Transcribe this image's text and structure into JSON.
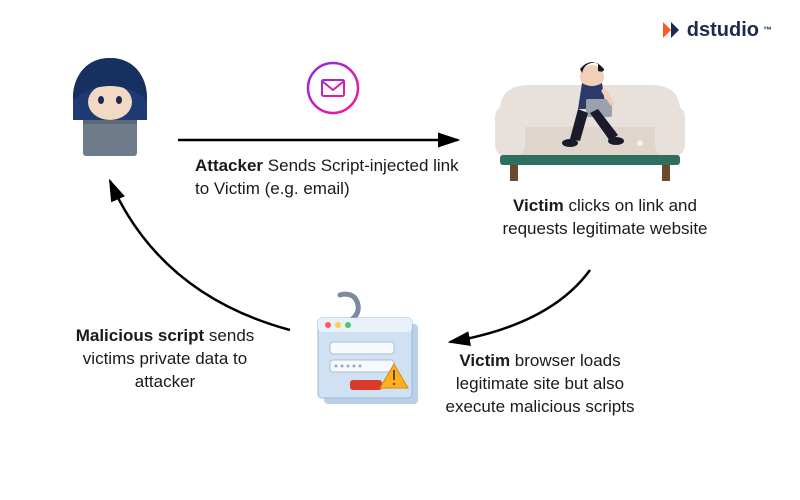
{
  "brand": {
    "name": "dstudio",
    "tm": "™"
  },
  "steps": {
    "step1": {
      "bold": "Attacker",
      "rest": " Sends Script-injected link to Victim (e.g. email)"
    },
    "step2": {
      "bold": "Victim",
      "rest": " clicks on link and requests legitimate website"
    },
    "step3": {
      "bold": "Victim",
      "rest": " browser loads legitimate site but also execute malicious scripts"
    },
    "step4": {
      "bold": "Malicious script",
      "rest": " sends victims private data to attacker"
    }
  },
  "icons": {
    "attacker": "attacker-hooded",
    "victim": "victim-on-sofa",
    "email": "envelope-circle",
    "phish": "phishing-login-window"
  }
}
